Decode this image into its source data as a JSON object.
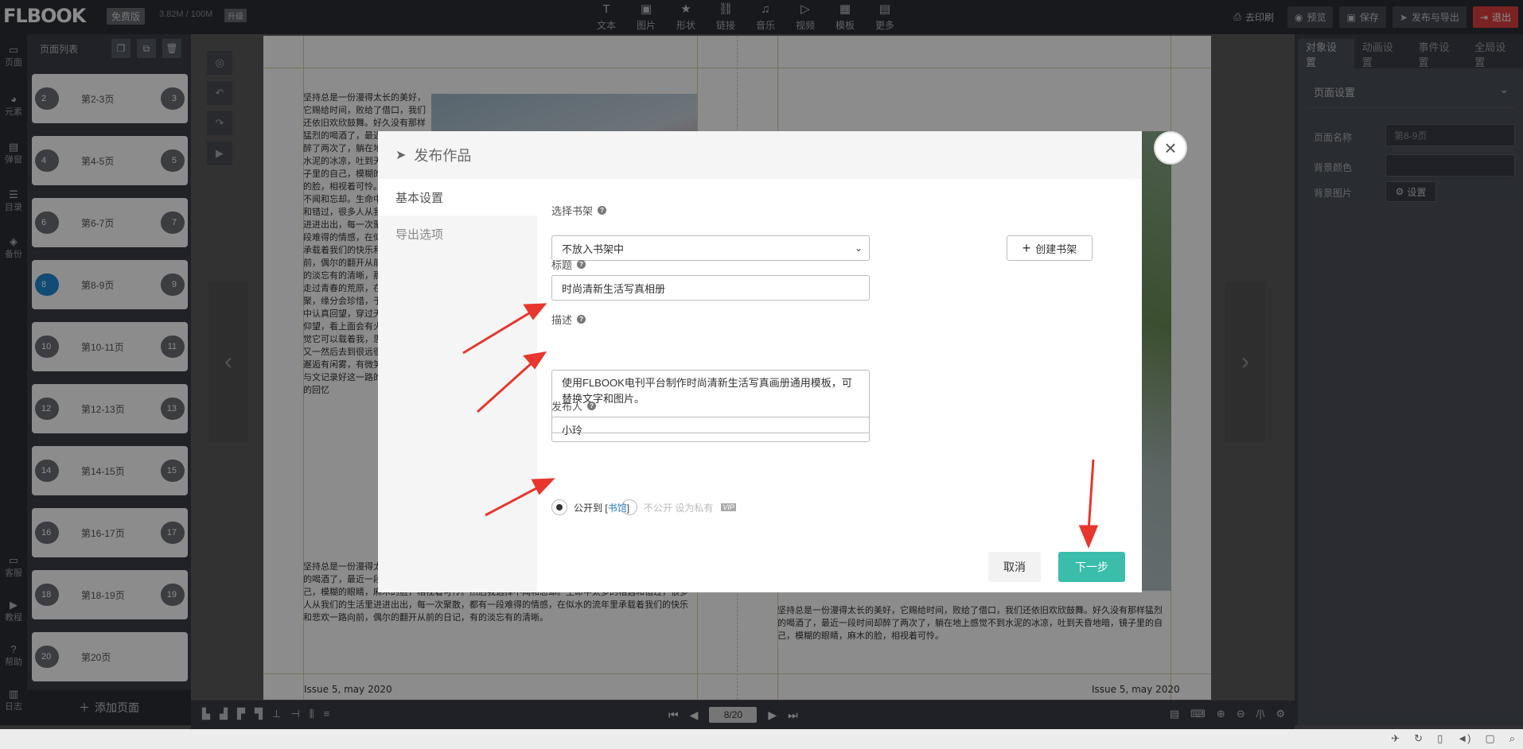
{
  "topbar": {
    "logo": "FLBOOK",
    "plan_badge": "免费版",
    "storage": "3.82M / 100M",
    "upgrade": "升级",
    "tools": [
      {
        "label": "文本",
        "icon": "T"
      },
      {
        "label": "图片",
        "icon": "▣"
      },
      {
        "label": "形状",
        "icon": "★"
      },
      {
        "label": "链接",
        "icon": "⛓"
      },
      {
        "label": "音乐",
        "icon": "♫"
      },
      {
        "label": "视频",
        "icon": "▷"
      },
      {
        "label": "模板",
        "icon": "▦"
      },
      {
        "label": "更多",
        "icon": "▤"
      }
    ],
    "print_label": "去印刷",
    "preview_label": "预览",
    "save_label": "保存",
    "publish_label": "发布与导出",
    "exit_label": "退出"
  },
  "iconbar": {
    "items": [
      "页面",
      "元素",
      "弹窗",
      "目录",
      "备份"
    ],
    "bottom_items": [
      "客服",
      "教程",
      "帮助",
      "日志"
    ]
  },
  "pagelist": {
    "title": "页面列表",
    "pages": [
      {
        "left": "2",
        "label": "第2-3页",
        "right": "3"
      },
      {
        "left": "4",
        "label": "第4-5页",
        "right": "5"
      },
      {
        "left": "6",
        "label": "第6-7页",
        "right": "7"
      },
      {
        "left": "8",
        "label": "第8-9页",
        "right": "9"
      },
      {
        "left": "10",
        "label": "第10-11页",
        "right": "11"
      },
      {
        "left": "12",
        "label": "第12-13页",
        "right": "13"
      },
      {
        "left": "14",
        "label": "第14-15页",
        "right": "15"
      },
      {
        "left": "16",
        "label": "第16-17页",
        "right": "17"
      },
      {
        "left": "18",
        "label": "第18-19页",
        "right": "19"
      },
      {
        "left": "20",
        "label": "第20页",
        "right": ""
      }
    ],
    "add_page": "添加页面"
  },
  "book": {
    "left_text": "坚持总是一份漫得太长的美好，它赐给时间，败给了借口，我们还依旧欢欣鼓舞。好久没有那样猛烈的喝酒了，最近一段时间却醉了两次了，躺在地上感觉不到水泥的冰凉，吐到天昏地暗，镜子里的自己，模糊的眼睛，麻木的脸，相视着可怜。然后我选择不闻和忘却。生命中太多的相遇和错过，很多人从我们的生活里进进出出，每一次聚散，都有一段难得的情感，在似水的流年里承载着我们的快乐和悲欢一路向前，偶尔的翻开从前的日记，有的淡忘有的清晰，那些人和事我走过青春的荒原，在日后岁月无聚，缘分会珍惜，于是我在静好中认真回望，穿过天桥，自然的仰望，看上面会有火车，那种感觉它可以载着我，思，经过一个又一然后去到很远很有风景，有邂逅有闲雾，有微笑可以用相机与文记录好这一路的收藏或轻松的回忆",
    "left_text_2": "坚持总是一份漫得太长的美好，它赐给时间，败给了借口，我们还依旧欢欣鼓舞。好久没有那样猛烈的喝酒了，最近一段时间却醉了两次了，躺在地上感觉不到水泥的冰凉，吐到天昏地暗，镜子里的自己，模糊的眼睛，麻木的脸，相视着可怜。然后我选择不闻和忘却。生命中太多的相遇和错过，很多人从我们的生活里进进出出，每一次聚散，都有一段难得的情感，在似水的流年里承载着我们的快乐和悲欢一路向前，偶尔的翻开从前的日记，有的淡忘有的清晰。",
    "right_text": "坚持总是一份漫得太长的美好，它赐给时间，败给了借口，我们还依旧欢欣鼓舞。好久没有那样猛烈的喝酒了，最近一段时间却醉了两次了，躺在地上感觉不到水泥的冰凉，吐到天昏地暗，镜子里的自己，模糊的眼睛，麻木的脸，相视着可怜。",
    "footer_left": "Issue 5, may 2020",
    "footer_right": "Issue 5, may 2020"
  },
  "bottombar": {
    "page_indicator": "8/20"
  },
  "rightpanel": {
    "tabs": [
      "对象设置",
      "动画设置",
      "事件设置",
      "全局设置"
    ],
    "section_title": "页面设置",
    "page_name_label": "页面名称",
    "page_name_value": "第8-9页",
    "bg_color_label": "背景颜色",
    "bg_image_label": "背景图片",
    "bg_image_button": "设置"
  },
  "modal": {
    "title": "发布作品",
    "nav": [
      "基本设置",
      "导出选项"
    ],
    "shelf_label": "选择书架",
    "shelf_value": "不放入书架中",
    "create_shelf": "创建书架",
    "title_label": "标题",
    "title_value": "时尚清新生活写真相册",
    "desc_label": "描述",
    "desc_value": "使用FLBOOK电刊平台制作时尚清新生活写真画册通用模板，可替换文字和图片。",
    "publisher_label": "发布人",
    "publisher_value": "小玲",
    "public_label_pre": "公开到",
    "public_label_link": "书馆",
    "private_label": "不公开 设为私有",
    "vip_badge": "VIP",
    "cancel": "取消",
    "next": "下一步"
  },
  "colors": {
    "accent": "#3bbdac",
    "exit": "#e04040",
    "arrow": "#e8362e"
  }
}
